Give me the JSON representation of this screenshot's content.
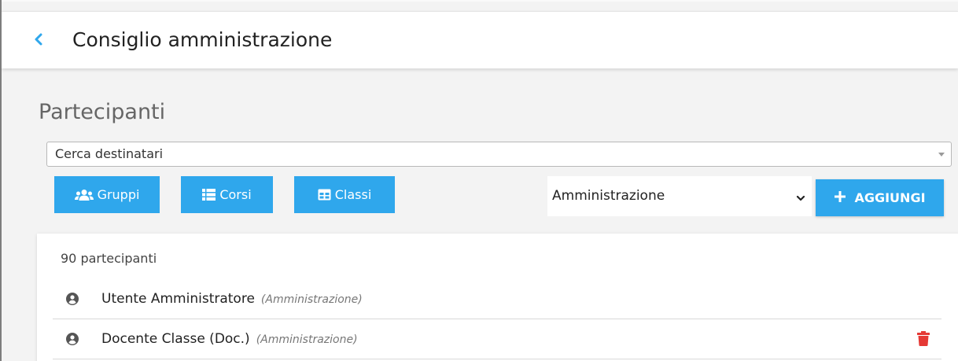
{
  "header": {
    "title": "Consiglio amministrazione"
  },
  "section": {
    "title": "Partecipanti"
  },
  "search": {
    "label": "Cerca destinatari"
  },
  "filters": {
    "groups_label": "Gruppi",
    "courses_label": "Corsi",
    "classes_label": "Classi"
  },
  "role_select": {
    "selected": "Amministrazione"
  },
  "add_button": {
    "label": "AGGIUNGI"
  },
  "participants": {
    "count_text": "90 partecipanti",
    "items": [
      {
        "name": "Utente Amministratore",
        "role": "(Amministrazione)"
      },
      {
        "name": "Docente Classe (Doc.)",
        "role": "(Amministrazione)"
      }
    ]
  },
  "colors": {
    "accent": "#2fa7ec",
    "delete": "#e53935"
  },
  "icons": {
    "back": "chevron-left-icon",
    "groups": "users-icon",
    "courses": "list-icon",
    "classes": "table-icon",
    "add": "plus-icon",
    "user": "user-circle-icon",
    "delete": "trash-icon"
  }
}
